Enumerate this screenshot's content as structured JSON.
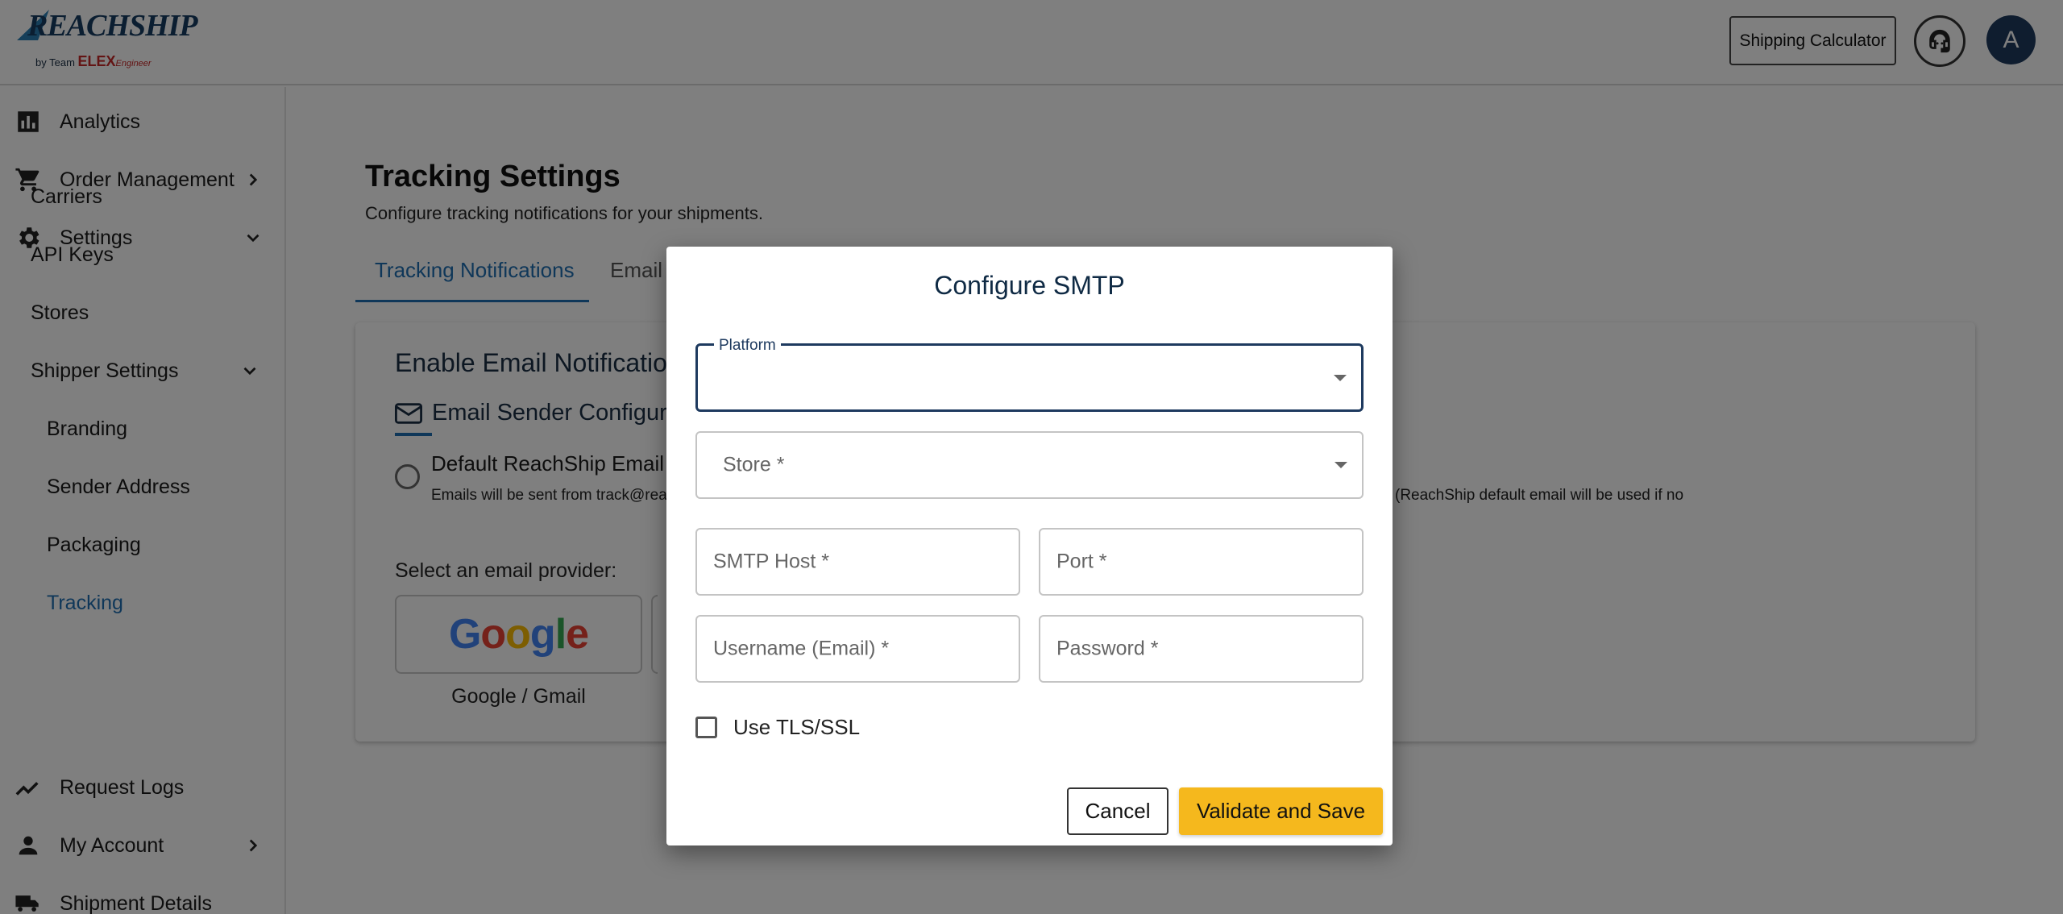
{
  "header": {
    "logo_text": "REACHSHIP",
    "logo_sub_prefix": "by Team",
    "logo_sub_brand": "ELEX",
    "logo_sub_suffix": "Engineer",
    "shipping_calculator_label": "Shipping Calculator",
    "support_icon": "headset-icon",
    "avatar_initial": "A"
  },
  "sidebar": {
    "items": [
      {
        "label": "Analytics",
        "icon": "bar-chart-icon"
      },
      {
        "label": "Order Management",
        "icon": "cart-icon"
      },
      {
        "label": "Settings",
        "icon": "gear-icon"
      },
      {
        "label": "Request Logs",
        "icon": "trend-line-icon"
      },
      {
        "label": "My Account",
        "icon": "person-icon"
      },
      {
        "label": "Shipment Details",
        "icon": "truck-icon"
      }
    ],
    "settings_children": [
      {
        "label": "Carriers"
      },
      {
        "label": "API Keys"
      },
      {
        "label": "Stores"
      },
      {
        "label": "Shipper Settings"
      }
    ],
    "shipper_children": [
      {
        "label": "Branding"
      },
      {
        "label": "Sender Address"
      },
      {
        "label": "Packaging"
      },
      {
        "label": "Tracking"
      }
    ]
  },
  "main": {
    "title": "Tracking Settings",
    "subtitle": "Configure tracking notifications for your shipments.",
    "tabs": [
      {
        "label": "Tracking Notifications"
      },
      {
        "label": "Email"
      }
    ],
    "card": {
      "heading": "Enable Email Notification",
      "sender_label": "Email Sender Configura",
      "radio_label": "Default ReachShip Email",
      "radio_desc": "Emails will be sent from track@rea",
      "radio_desc_right": "(ReachShip default email will be used if no",
      "provider_prompt": "Select an email provider:",
      "provider_name": "Google / Gmail"
    }
  },
  "modal": {
    "title": "Configure SMTP",
    "platform_label": "Platform",
    "store_label": "Store *",
    "smtp_host_label": "SMTP Host *",
    "port_label": "Port *",
    "username_label": "Username (Email) *",
    "password_label": "Password *",
    "tls_label": "Use TLS/SSL",
    "tls_checked": false,
    "cancel_label": "Cancel",
    "save_label": "Validate and Save"
  },
  "colors": {
    "accent": "#1f6fb2",
    "primary_dark": "#1e3a5f",
    "save_button": "#f5b81d",
    "overlay": "rgba(0,0,0,0.5)"
  }
}
